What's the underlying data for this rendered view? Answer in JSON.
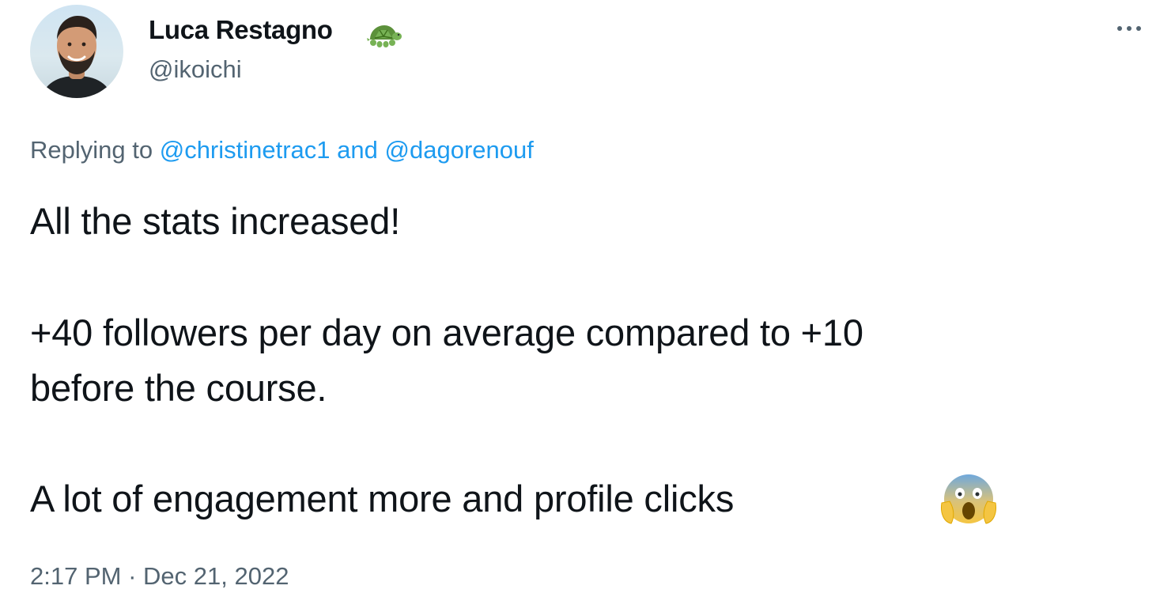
{
  "author": {
    "display_name": "Luca Restagno",
    "name_emoji": "turtle-emoji",
    "handle": "@ikoichi"
  },
  "more_button": {
    "icon": "more-horizontal-icon"
  },
  "reply_context": {
    "prefix": "Replying to",
    "user1": "@christinetrac1",
    "conjunction": "and",
    "user2": "@dagorenouf"
  },
  "body": {
    "line1": "All the stats increased!",
    "line2": "+40 followers per day on average compared to +10",
    "line3": "before the course.",
    "line4": "A lot of engagement more and profile clicks",
    "line4_emoji": "screaming-face-emoji"
  },
  "timestamp": {
    "time": "2:17 PM",
    "separator": "·",
    "date": "Dec 21, 2022"
  },
  "colors": {
    "text_primary": "#0f1419",
    "text_secondary": "#536471",
    "link": "#1d9bf0",
    "background": "#ffffff"
  }
}
